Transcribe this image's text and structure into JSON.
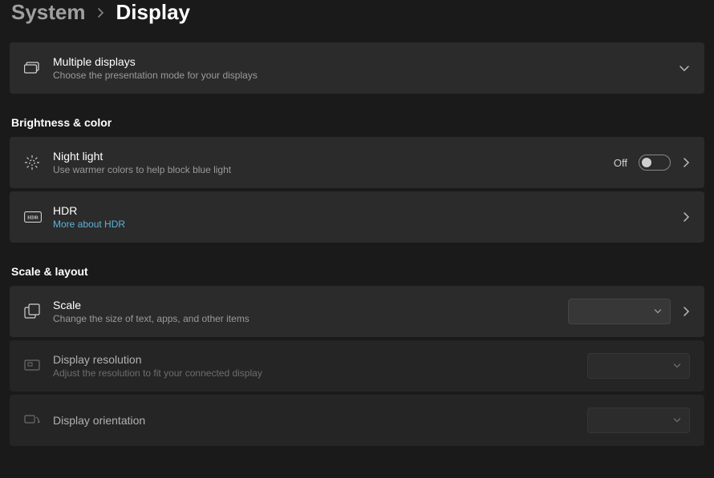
{
  "breadcrumb": {
    "parent": "System",
    "current": "Display"
  },
  "top": {
    "multiple_displays": {
      "title": "Multiple displays",
      "sub": "Choose the presentation mode for your displays"
    }
  },
  "sections": {
    "brightness_color": {
      "header": "Brightness & color",
      "night_light": {
        "title": "Night light",
        "sub": "Use warmer colors to help block blue light",
        "toggle_label": "Off"
      },
      "hdr": {
        "title": "HDR",
        "link": "More about HDR"
      }
    },
    "scale_layout": {
      "header": "Scale & layout",
      "scale": {
        "title": "Scale",
        "sub": "Change the size of text, apps, and other items"
      },
      "resolution": {
        "title": "Display resolution",
        "sub": "Adjust the resolution to fit your connected display"
      },
      "orientation": {
        "title": "Display orientation"
      }
    }
  }
}
